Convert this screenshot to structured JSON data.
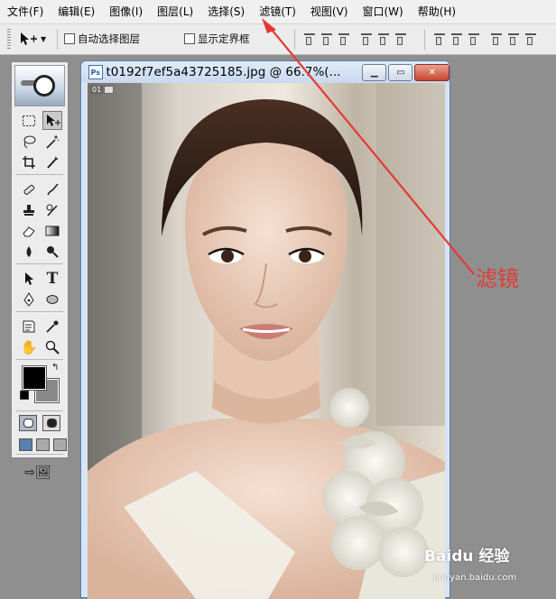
{
  "menu": {
    "items": [
      "文件(F)",
      "编辑(E)",
      "图像(I)",
      "图层(L)",
      "选择(S)",
      "滤镜(T)",
      "视图(V)",
      "窗口(W)",
      "帮助(H)"
    ]
  },
  "options": {
    "auto_select_label": "自动选择图层",
    "show_bounds_label": "显示定界框"
  },
  "document": {
    "title": "t0192f7ef5a43725185.jpg @ 66.7%(...",
    "layer_indicator": "01"
  },
  "annotation": {
    "label": "滤镜",
    "color": "#e53a34"
  },
  "watermark": {
    "brand": "Baidu 经验",
    "url": "jingyan.baidu.com"
  }
}
